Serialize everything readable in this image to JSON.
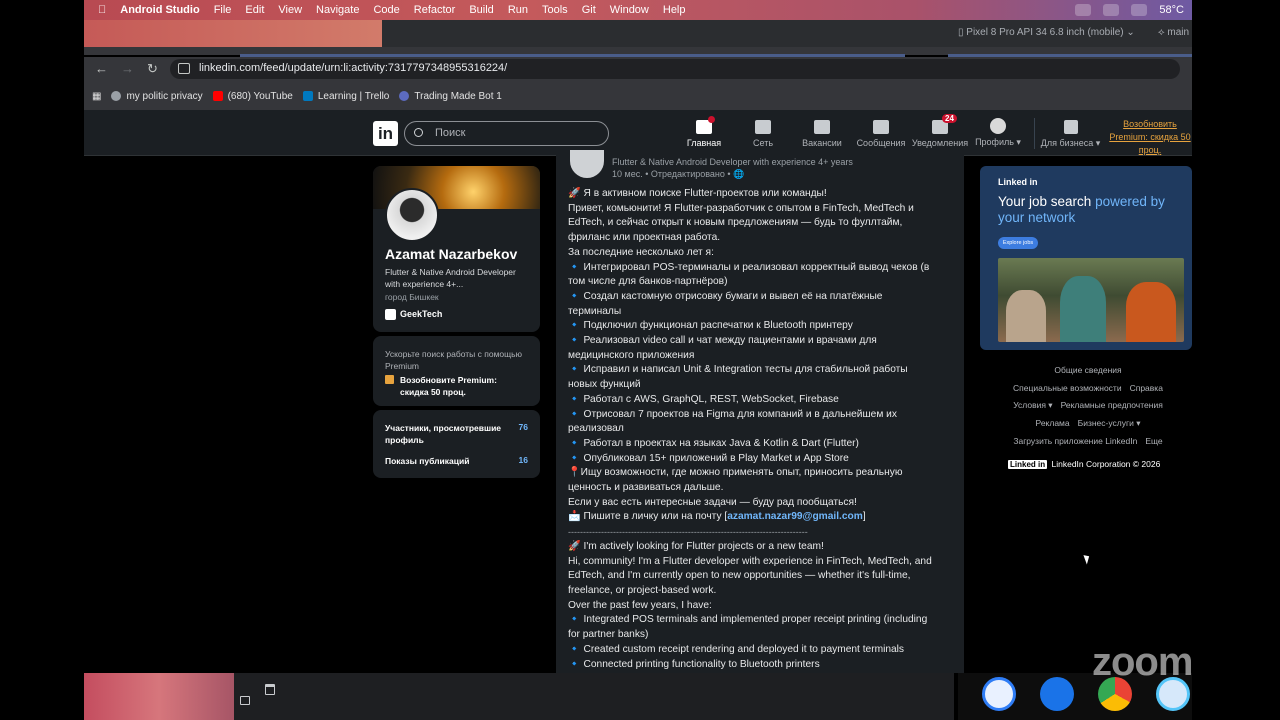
{
  "menubar": {
    "items": [
      "Android Studio",
      "File",
      "Edit",
      "View",
      "Navigate",
      "Code",
      "Refactor",
      "Build",
      "Run",
      "Tools",
      "Git",
      "Window",
      "Help"
    ],
    "temperature": "58°C"
  },
  "ide": {
    "device": "Pixel 8 Pro API 34 6.8 inch (mobile)",
    "branch": "main"
  },
  "browser": {
    "url": "linkedin.com/feed/update/urn:li:activity:7317797348955316224/",
    "bookmarks": [
      "my politic privacy",
      "(680) YouTube",
      "Learning | Trello",
      "Trading Made Bot 1"
    ]
  },
  "linkedin": {
    "logo": "in",
    "search_placeholder": "Поиск",
    "nav": [
      {
        "label": "Главная",
        "badge": ""
      },
      {
        "label": "Сеть",
        "badge": ""
      },
      {
        "label": "Вакансии",
        "badge": ""
      },
      {
        "label": "Сообщения",
        "badge": ""
      },
      {
        "label": "Уведомления",
        "badge": "24"
      },
      {
        "label": "Профиль ▾",
        "badge": ""
      },
      {
        "label": "Для бизнеса ▾",
        "badge": ""
      }
    ],
    "premium_link": "Возобновить Premium: скидка 50 проц."
  },
  "profile": {
    "name": "Azamat Nazarbekov",
    "headline": "Flutter & Native Android Developer with experience 4+...",
    "location": "город Бишкек",
    "company": "GeekTech"
  },
  "premium_card": {
    "text": "Ускорьте поиск работы с помощью Premium",
    "cta": "Возобновите Premium: скидка 50 проц."
  },
  "stats": [
    {
      "label": "Участники, просмотревшие профиль",
      "value": "76"
    },
    {
      "label": "Показы публикаций",
      "value": "16"
    }
  ],
  "post": {
    "headline": "Flutter & Native Android Developer with experience 4+ years",
    "meta": "10 мес. • Отредактировано •",
    "lines": [
      "🚀 Я в активном поиске Flutter-проектов или команды!",
      "Привет, комьюнити! Я Flutter-разработчик с опытом в FinTech, MedTech и",
      "EdTech, и сейчас открыт к новым предложениям — будь то фуллтайм,",
      "фриланс или проектная работа.",
      "За последние несколько лет я:",
      "🔹 Интегрировал POS-терминалы и реализовал корректный вывод чеков (в",
      "том числе для банков-партнёров)",
      "🔹 Создал кастомную отрисовку бумаги и вывел её на платёжные",
      "терминалы",
      "🔹 Подключил функционал распечатки к Bluetooth принтеру",
      "🔹 Реализовал video call и чат между пациентами и врачами для",
      "медицинского приложения",
      "🔹 Исправил и написал Unit & Integration тесты для стабильной работы",
      "новых функций",
      "🔹 Работал с AWS, GraphQL, REST, WebSocket, Firebase",
      "🔹 Отрисовал 7 проектов на Figma для компаний и в дальнейшем их",
      "реализовал",
      "🔹 Работал в проектах на языках Java & Kotlin & Dart (Flutter)",
      "🔹 Опубликовал 15+ приложений в Play Market и App Store",
      "📍Ищу возможности, где можно применять опыт, приносить реальную",
      "ценность и развиваться дальше.",
      "Если у вас есть интересные задачи — буду рад пообщаться!"
    ],
    "contact_prefix": "📩 Пишите в личку или на почту [",
    "contact_email": "azamat.nazar99@gmail.com",
    "contact_suffix": "]",
    "separator": "--------------------------------------------------------------------------------",
    "lines_en": [
      "🚀 I'm actively looking for Flutter projects or a new team!",
      "Hi, community! I'm a Flutter developer with experience in FinTech, MedTech, and",
      "EdTech, and I'm currently open to new opportunities — whether it's full-time,",
      "freelance, or project-based work.",
      "Over the past few years, I have:",
      "🔹 Integrated POS terminals and implemented proper receipt printing (including",
      "for partner banks)",
      "🔹 Created custom receipt rendering and deployed it to payment terminals",
      "🔹 Connected printing functionality to Bluetooth printers"
    ]
  },
  "ad": {
    "brand": "Linked in",
    "title_a": "Your job search ",
    "title_b": "powered by",
    "title_c": "your network",
    "button": "Explore jobs"
  },
  "footer": {
    "links": [
      "Общие сведения",
      "Специальные возможности",
      "Справка",
      "Условия ▾",
      "Рекламные предпочтения",
      "Реклама",
      "Бизнес-услуги ▾",
      "Загрузить приложение LinkedIn",
      "Еще"
    ],
    "corp": "LinkedIn Corporation © 2026",
    "logo": "Linked in"
  },
  "overlay": {
    "zoom": "zoom"
  }
}
